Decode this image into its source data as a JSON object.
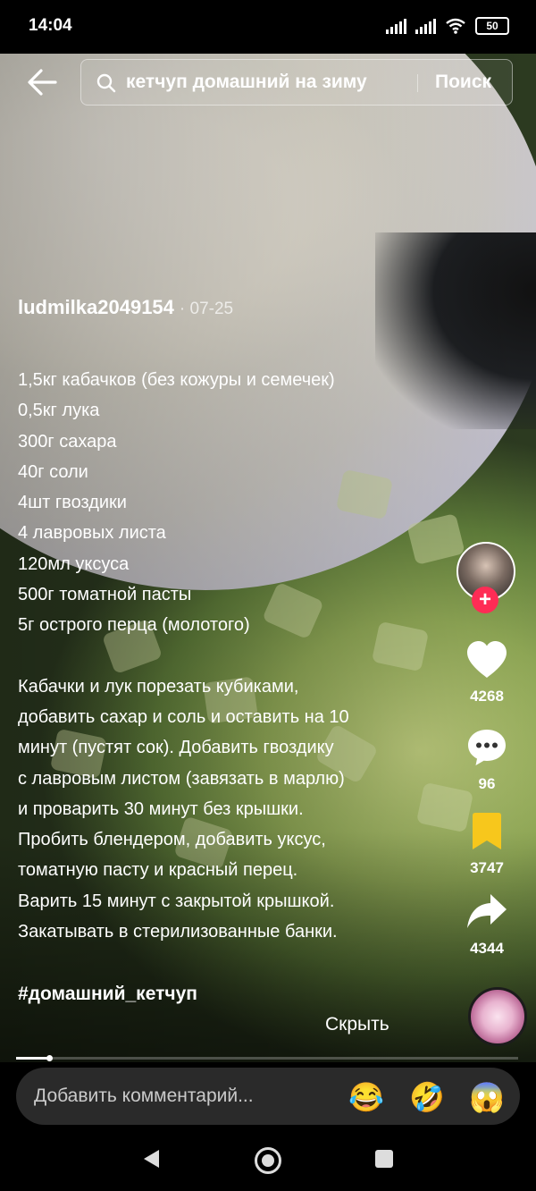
{
  "status_bar": {
    "time": "14:04",
    "battery": "50"
  },
  "search": {
    "query": "кетчуп домашний на зиму",
    "button_label": "Поиск"
  },
  "post": {
    "author": "ludmilka2049154",
    "date": "· 07-25",
    "ingredients": [
      "1,5кг кабачков (без кожуры и семечек)",
      "0,5кг лука",
      "300г сахара",
      "40г соли",
      "4шт гвоздики",
      "4 лавровых листа",
      "120мл уксуса",
      "500г томатной пасты",
      "5г острого перца (молотого)"
    ],
    "instructions": [
      "Кабачки и лук порезать кубиками,",
      "добавить сахар и соль и оставить на 10",
      "минут (пустят сок). Добавить гвоздику",
      "с лавровым листом (завязать в марлю)",
      "и проварить 30 минут без крышки.",
      "Пробить блендером, добавить уксус,",
      "томатную пасту и красный перец.",
      "Варить 15 минут с закрытой крышкой.",
      "Закатывать в стерилизованные банки."
    ],
    "hashtag": "#домашний_кетчуп",
    "hide_label": "Скрыть"
  },
  "actions": {
    "likes": "4268",
    "comments": "96",
    "saves": "3747",
    "shares": "4344",
    "follow_symbol": "+"
  },
  "playback": {
    "progress_fraction": 0.065
  },
  "comment_bar": {
    "placeholder": "Добавить комментарий...",
    "emojis": [
      "😂",
      "🤣",
      "😱"
    ]
  },
  "colors": {
    "accent": "#fe2c55",
    "save_yellow": "#f7c71c"
  }
}
